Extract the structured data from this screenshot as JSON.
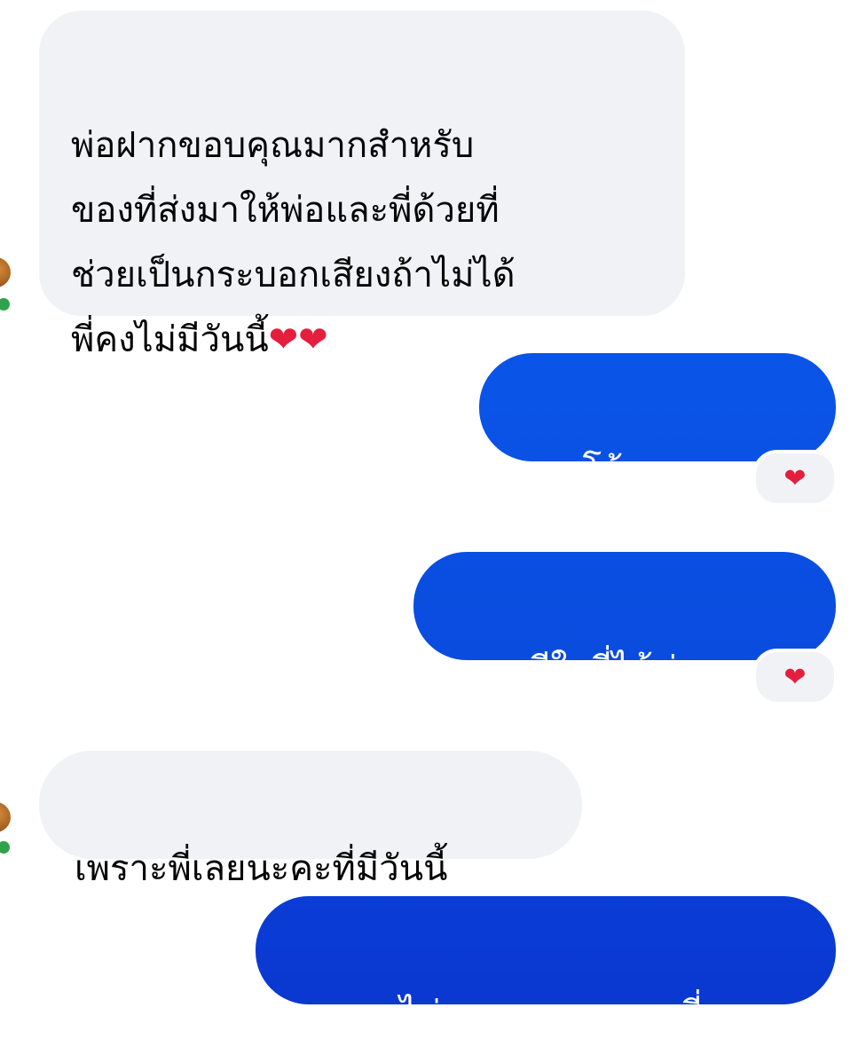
{
  "colors": {
    "incoming_bubble": "#f1f2f6",
    "outgoing_gradient_top": "#0a55e8",
    "outgoing_gradient_bottom": "#0a3ad2",
    "heart": "#e41e3f",
    "online_status": "#31a24c"
  },
  "messages": [
    {
      "direction": "incoming",
      "text": "พ่อฝากขอบคุณมากสำหรับ\nของที่ส่งมาให้พ่อและพี่ด้วยที่\nช่วยเป็นกระบอกเสียงถ้าไม่ได้\nพี่คงไม่มีวันนี้",
      "emoji": "❤❤",
      "reaction": null
    },
    {
      "direction": "outgoing",
      "text": "โอ้ เยอะเลยยย",
      "reaction": "❤"
    },
    {
      "direction": "outgoing",
      "text": "ดีใจที่ได้ช่วยนะคะ",
      "reaction": "❤"
    },
    {
      "direction": "incoming",
      "text": "เพราะพี่เลยนะคะที่มีวันนี้",
      "reaction": null
    },
    {
      "direction": "outgoing",
      "text": "ไม่หรอก เพราะคนที่เมตตา",
      "reaction": null
    }
  ]
}
